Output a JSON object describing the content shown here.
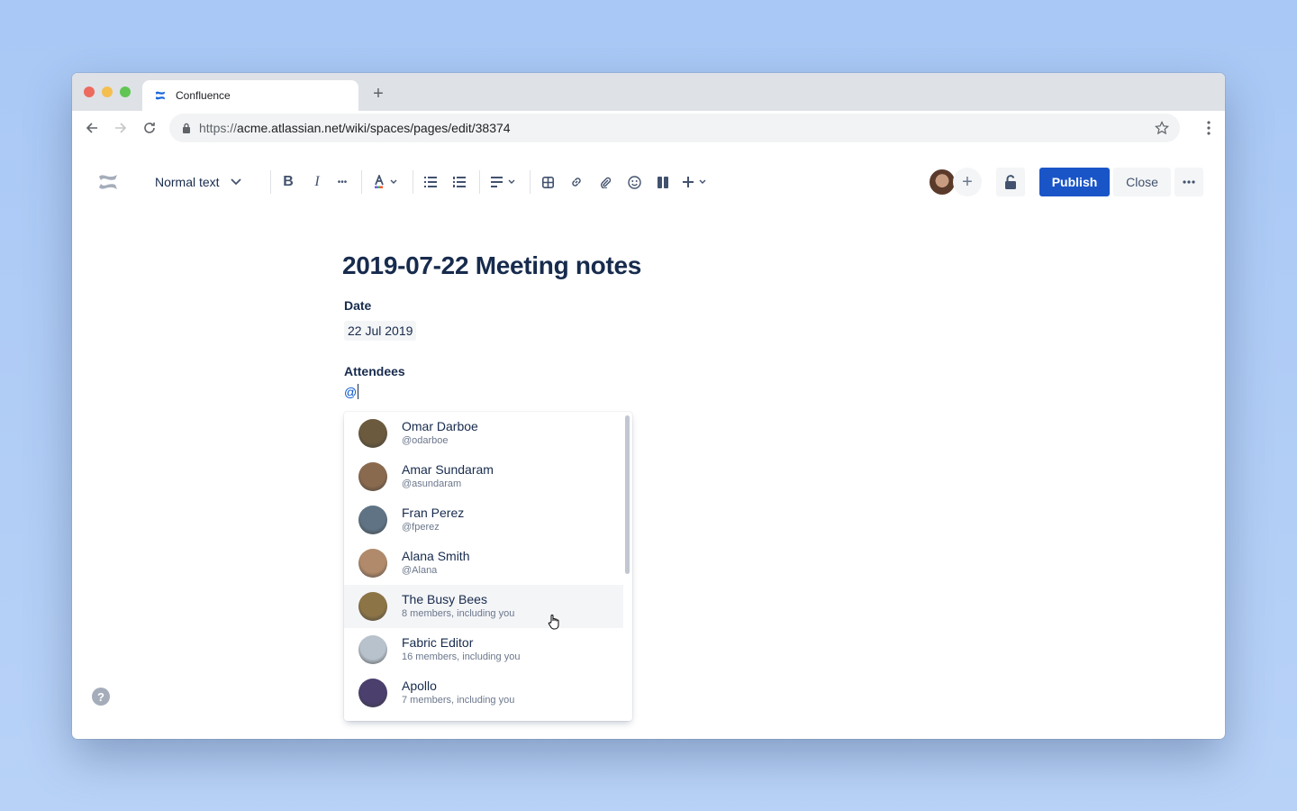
{
  "browser": {
    "tab_title": "Confluence",
    "new_tab": "+",
    "url_protocol": "https://",
    "url_rest": "acme.atlassian.net/wiki/spaces/pages/edit/38374"
  },
  "toolbar": {
    "text_style": "Normal text",
    "publish_label": "Publish",
    "close_label": "Close",
    "invite_label": "+",
    "more_label": "•••",
    "icons": [
      "bold-icon",
      "italic-icon",
      "more-formatting-icon",
      "text-color-icon",
      "bullet-list-icon",
      "numbered-list-icon",
      "align-icon",
      "table-icon",
      "link-icon",
      "attachment-icon",
      "emoji-icon",
      "layout-icon",
      "insert-icon"
    ]
  },
  "page": {
    "title": "2019-07-22 Meeting notes",
    "date_label": "Date",
    "date_value": "22 Jul 2019",
    "attendees_label": "Attendees",
    "mention_input": "@"
  },
  "mention_list": {
    "items": [
      {
        "name": "Omar Darboe",
        "sub": "@odarboe",
        "color": "#6b5a3e"
      },
      {
        "name": "Amar Sundaram",
        "sub": "@asundaram",
        "color": "#8a6a4e"
      },
      {
        "name": "Fran Perez",
        "sub": "@fperez",
        "color": "#5f7384"
      },
      {
        "name": "Alana Smith",
        "sub": "@Alana",
        "color": "#b08a6a"
      },
      {
        "name": "The Busy Bees",
        "sub": "8 members, including you",
        "color": "#8c7446"
      },
      {
        "name": "Fabric Editor",
        "sub": "16 members, including you",
        "color": "#b8c2cc"
      },
      {
        "name": "Apollo",
        "sub": "7 members, including you",
        "color": "#4b3f6e"
      }
    ],
    "hovered_index": 4
  },
  "help_label": "?"
}
